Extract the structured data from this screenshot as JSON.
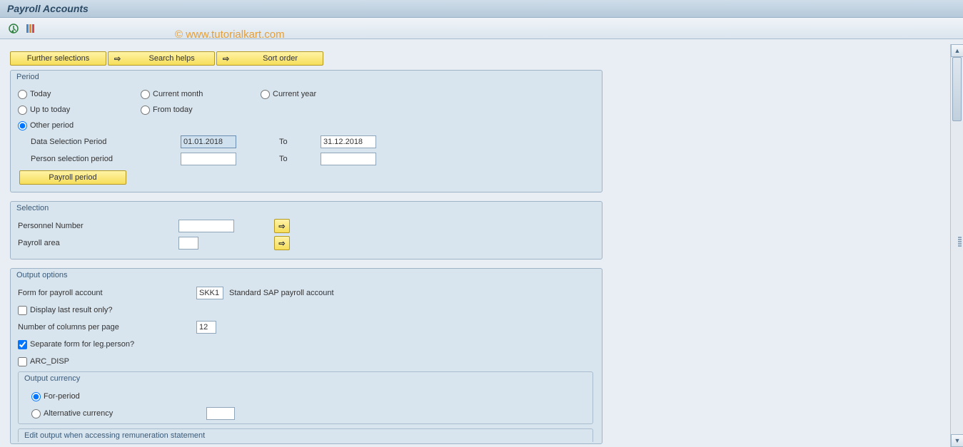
{
  "title": "Payroll Accounts",
  "watermark": "© www.tutorialkart.com",
  "topButtons": {
    "further": "Further selections",
    "search": "Search helps",
    "sort": "Sort order"
  },
  "period": {
    "title": "Period",
    "today": "Today",
    "currentMonth": "Current month",
    "currentYear": "Current year",
    "upToToday": "Up to today",
    "fromToday": "From today",
    "otherPeriod": "Other period",
    "dataSelectionLabel": "Data Selection Period",
    "dataSelectionFrom": "01.01.2018",
    "to": "To",
    "dataSelectionTo": "31.12.2018",
    "personSelectionLabel": "Person selection period",
    "personSelectionFrom": "",
    "personSelectionTo": "",
    "payrollPeriodBtn": "Payroll period"
  },
  "selection": {
    "title": "Selection",
    "personnelNumberLabel": "Personnel Number",
    "personnelNumberValue": "",
    "payrollAreaLabel": "Payroll area",
    "payrollAreaValue": ""
  },
  "output": {
    "title": "Output options",
    "formLabel": "Form for payroll account",
    "formValue": "SKK1",
    "formDesc": "Standard SAP payroll account",
    "displayLast": "Display last result only?",
    "numColsLabel": "Number of columns per page",
    "numColsValue": "12",
    "separateForm": "Separate form for leg.person?",
    "arcDisp": "ARC_DISP",
    "currency": {
      "title": "Output currency",
      "forPeriod": "For-period",
      "altCurrency": "Alternative currency",
      "altCurrencyValue": ""
    },
    "editOutput": {
      "title": "Edit output when accessing remuneration statement"
    }
  }
}
